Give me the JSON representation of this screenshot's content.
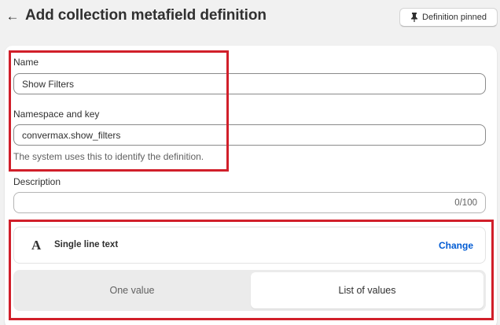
{
  "header": {
    "back_icon": "arrow-left-icon",
    "title": "Add collection metafield definition",
    "pin_button": {
      "icon": "pin-icon",
      "label": "Definition pinned"
    }
  },
  "form": {
    "name": {
      "label": "Name",
      "value": "Show Filters"
    },
    "namespace_key": {
      "label": "Namespace and key",
      "value": "convermax.show_filters",
      "help": "The system uses this to identify the definition."
    },
    "description": {
      "label": "Description",
      "value": "",
      "counter": "0/100"
    },
    "type": {
      "icon_glyph": "A",
      "label": "Single line text",
      "change_label": "Change"
    },
    "value_mode": {
      "options": [
        "One value",
        "List of values"
      ],
      "selected": "List of values"
    }
  },
  "colors": {
    "annotation": "#d11f2a",
    "link": "#005bd3",
    "background": "#f1f1f1"
  }
}
